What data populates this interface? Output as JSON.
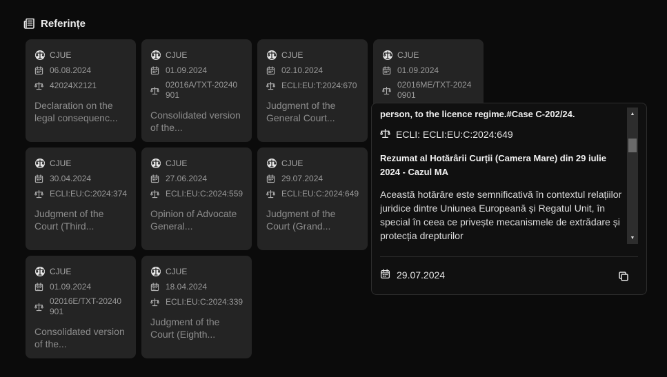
{
  "header": {
    "title": "Referințe"
  },
  "cards": [
    {
      "source": "CJUE",
      "date": "06.08.2024",
      "ref": "42024X2121",
      "title": "Declaration on the legal consequenc..."
    },
    {
      "source": "CJUE",
      "date": "01.09.2024",
      "ref": "02016A/TXT-20240901",
      "title": "Consolidated version of the..."
    },
    {
      "source": "CJUE",
      "date": "02.10.2024",
      "ref": "ECLI:EU:T:2024:670",
      "title": "Judgment of the General Court..."
    },
    {
      "source": "CJUE",
      "date": "01.09.2024",
      "ref": "02016ME/TXT-20240901",
      "title": ""
    },
    {
      "source": "CJUE",
      "date": "30.04.2024",
      "ref": "ECLI:EU:C:2024:374",
      "title": "Judgment of the Court (Third..."
    },
    {
      "source": "CJUE",
      "date": "27.06.2024",
      "ref": "ECLI:EU:C:2024:559",
      "title": "Opinion of Advocate General..."
    },
    {
      "source": "CJUE",
      "date": "29.07.2024",
      "ref": "ECLI:EU:C:2024:649",
      "title": "Judgment of the Court (Grand..."
    },
    {
      "source": "CJUE",
      "date": "01.09.2024",
      "ref": "02016E/TXT-20240901",
      "title": "Consolidated version of the..."
    },
    {
      "source": "CJUE",
      "date": "18.04.2024",
      "ref": "ECLI:EU:C:2024:339",
      "title": "Judgment of the Court (Eighth..."
    }
  ],
  "popover": {
    "line1": "person, to the licence regime.#Case C-202/24.",
    "ecli": "ECLI: ECLI:EU:C:2024:649",
    "heading": "Rezumat al Hotărârii Curții (Camera Mare) din 29 iulie 2024 - Cazul MA",
    "body": "Această hotărâre este semnificativă în contextul relațiilor juridice dintre Uniunea Europeană și Regatul Unit, în special în ceea ce privește mecanismele de extrădare și protecția drepturilor",
    "date": "29.07.2024",
    "scroll_fraction": 0.2
  }
}
